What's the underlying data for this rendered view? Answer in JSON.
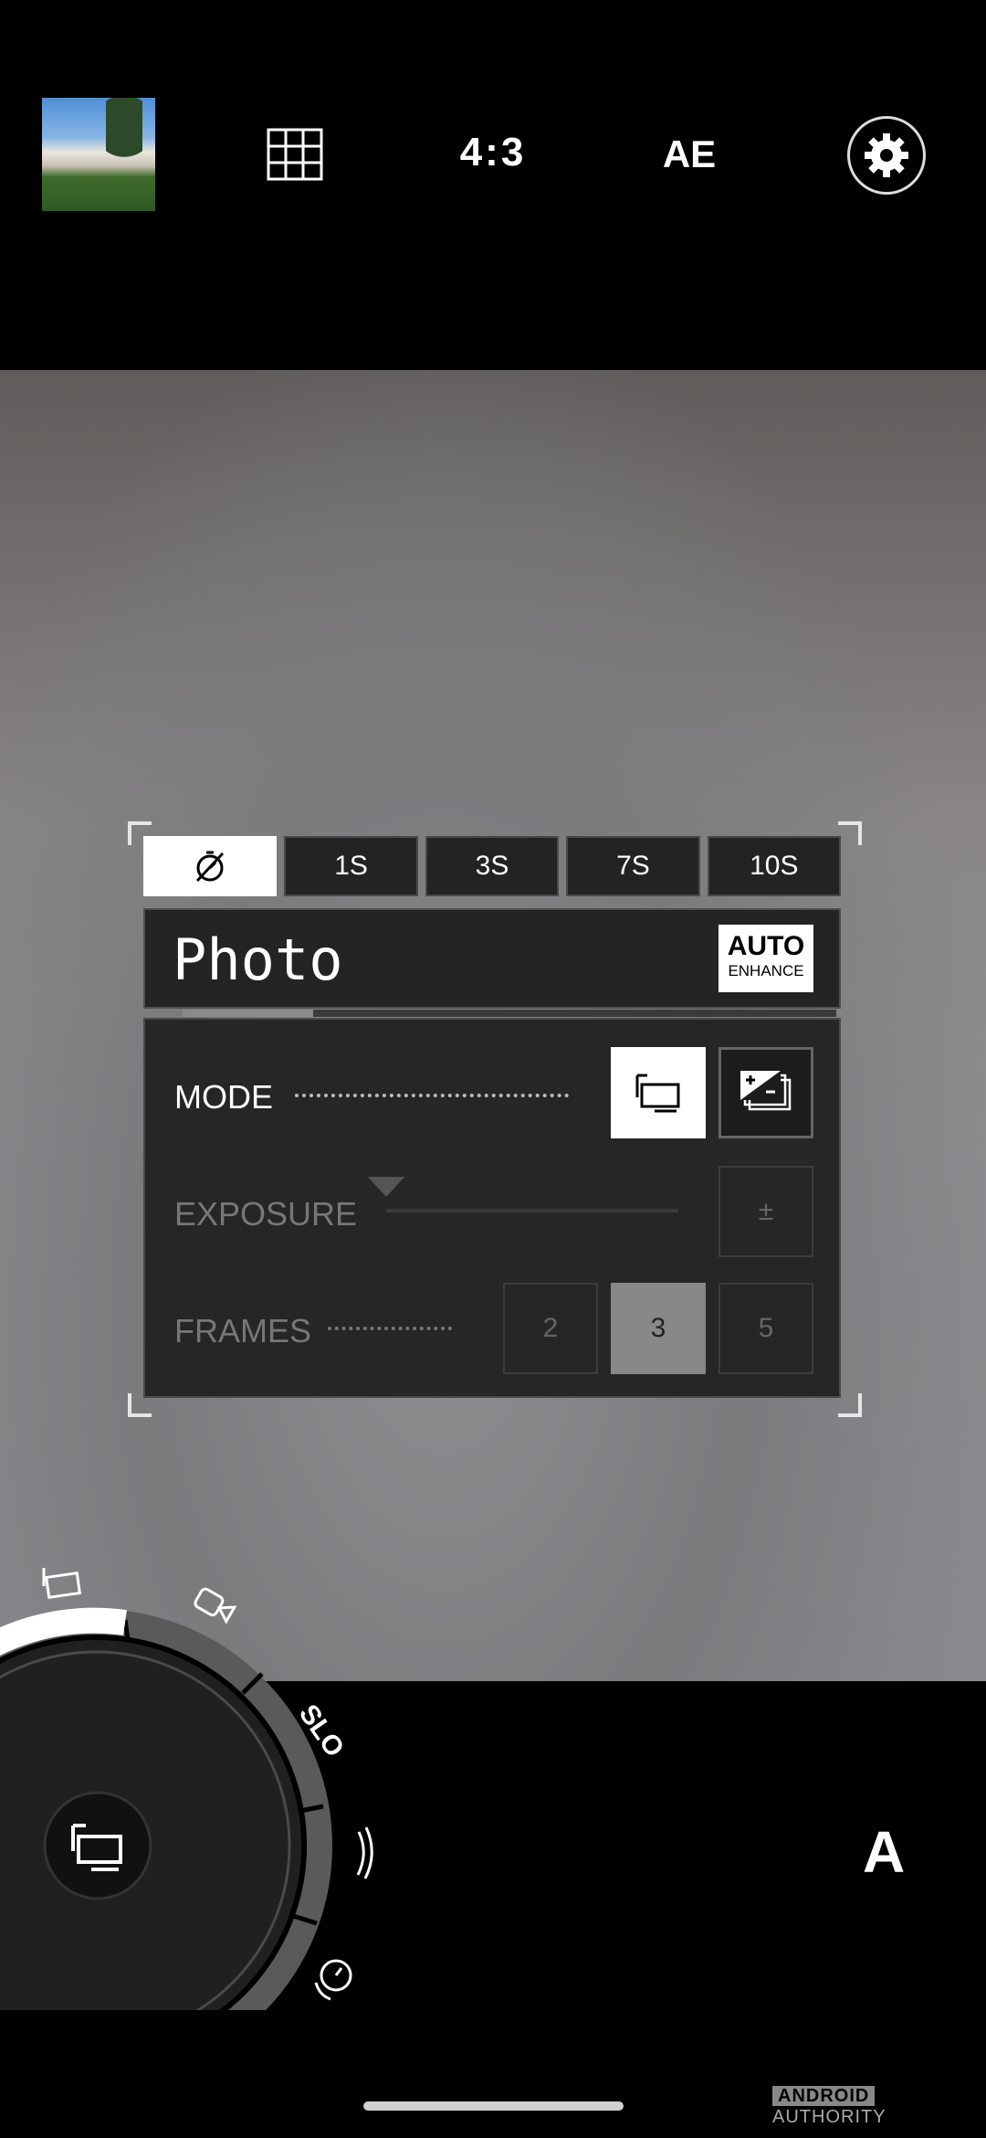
{
  "top_bar": {
    "aspect_ratio": "4:3",
    "exposure_label": "AE"
  },
  "timer": {
    "options": [
      "1S",
      "3S",
      "7S",
      "10S"
    ]
  },
  "mode_panel": {
    "title": "Photo",
    "auto_line1": "AUTO",
    "auto_line2": "ENHANCE",
    "progress": 0.2
  },
  "settings": {
    "mode_label": "MODE",
    "exposure_label": "EXPOSURE",
    "exposure_button": "±",
    "frames_label": "FRAMES",
    "frames": [
      "2",
      "3",
      "5"
    ],
    "selected_frames": "3"
  },
  "dial": {
    "slo_label": "SLO"
  },
  "bottom": {
    "auto_mode": "A"
  },
  "watermark": {
    "part1": "ANDROID",
    "part2": "AUTHORITY"
  }
}
